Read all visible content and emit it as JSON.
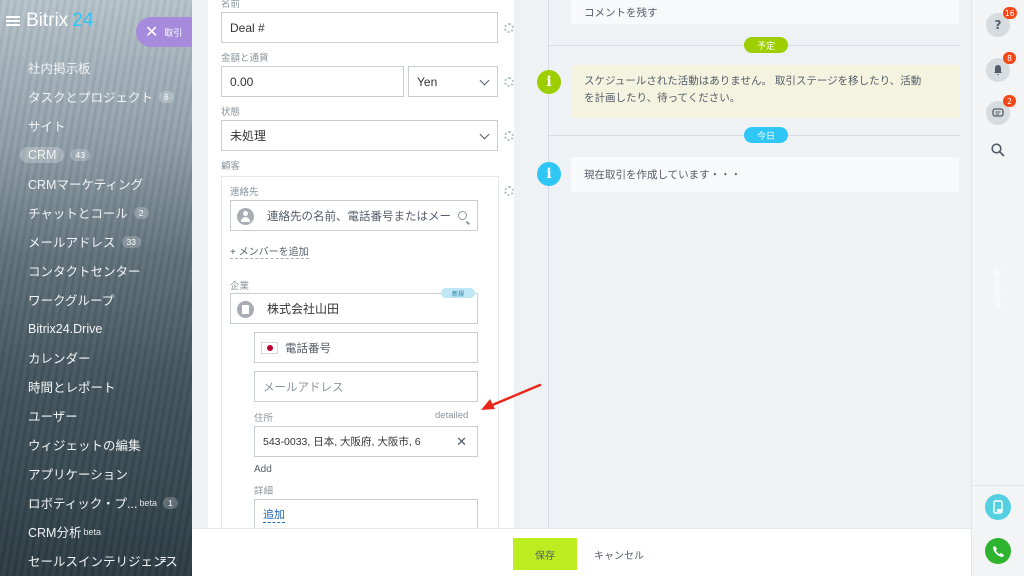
{
  "app": {
    "logo_text": "Bitrix",
    "logo_number": "24"
  },
  "close_tab": {
    "label": "取引"
  },
  "sidebar": {
    "items": [
      {
        "label": "社内掲示板",
        "count": ""
      },
      {
        "label": "タスクとプロジェクト",
        "count": "6"
      },
      {
        "label": "サイト",
        "count": ""
      },
      {
        "label": "CRM",
        "count": "43"
      },
      {
        "label": "CRMマーケティング",
        "count": ""
      },
      {
        "label": "チャットとコール",
        "count": "2"
      },
      {
        "label": "メールアドレス",
        "count": "33"
      },
      {
        "label": "コンタクトセンター",
        "count": ""
      },
      {
        "label": "ワークグループ",
        "count": ""
      },
      {
        "label": "Bitrix24.Drive",
        "count": ""
      },
      {
        "label": "カレンダー",
        "count": ""
      },
      {
        "label": "時間とレポート",
        "count": ""
      },
      {
        "label": "ユーザー",
        "count": ""
      },
      {
        "label": "ウィジェットの編集",
        "count": ""
      },
      {
        "label": "アプリケーション",
        "count": ""
      },
      {
        "label": "ロボティック・プ...",
        "sup": "beta",
        "count": "1"
      },
      {
        "label": "CRM分析",
        "sup": "beta",
        "count": ""
      },
      {
        "label": "セールスインテリジェンス",
        "count": ""
      }
    ]
  },
  "form": {
    "name_label": "名前",
    "name_value": "Deal #",
    "amount_label": "金額と通貨",
    "amount_value": "0.00",
    "currency_value": "Yen",
    "status_label": "状態",
    "status_value": "未処理",
    "client_label": "顧客",
    "contact_label": "連絡先",
    "contact_placeholder": "連絡先の名前、電話番号またはメー",
    "add_member": "+ メンバーを追加",
    "company_label": "企業",
    "new_badge": "新規",
    "company_value": "株式会社山田",
    "phone_placeholder": "電話番号",
    "email_placeholder": "メールアドレス",
    "address_label": "住所",
    "address_detailed": "detailed",
    "address_value": "543-0033, 日本, 大阪府, 大阪市, 6",
    "address_add": "Add",
    "details_label": "詳細",
    "details_add": "追加"
  },
  "timeline": {
    "comment_text": "コメントを残す",
    "planned_badge": "予定",
    "planned_text_1": "スケジュールされた活動はありません。 取引ステージを移したり、活動",
    "planned_text_2": "を計画したり、待ってください。",
    "today_badge": "今日",
    "creating_text": "現在取引を作成しています・・・",
    "planned_color": "#9dcf00",
    "today_color": "#2fc6f6"
  },
  "footer": {
    "save_label": "保存",
    "cancel_label": "キャンセル"
  },
  "rightbar": {
    "help_count": "16",
    "notifications_count": "8",
    "chat_count": "2",
    "vertical_text": "取引を作成"
  }
}
